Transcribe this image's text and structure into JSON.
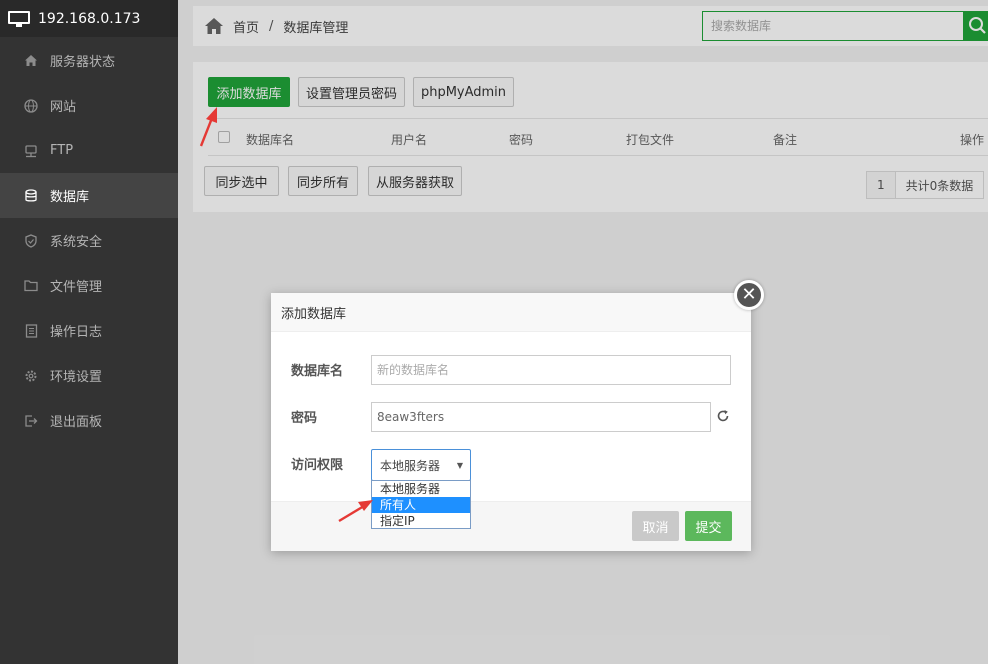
{
  "sidebar": {
    "server_ip": "192.168.0.173",
    "items": [
      {
        "label": "服务器状态",
        "icon": "home-icon"
      },
      {
        "label": "网站",
        "icon": "globe-icon"
      },
      {
        "label": "FTP",
        "icon": "ftp-icon"
      },
      {
        "label": "数据库",
        "icon": "database-icon",
        "active": true
      },
      {
        "label": "系统安全",
        "icon": "shield-icon"
      },
      {
        "label": "文件管理",
        "icon": "folder-icon"
      },
      {
        "label": "操作日志",
        "icon": "log-icon"
      },
      {
        "label": "环境设置",
        "icon": "gear-icon"
      },
      {
        "label": "退出面板",
        "icon": "logout-icon"
      }
    ]
  },
  "breadcrumb": {
    "home": "首页",
    "separator": "/",
    "current": "数据库管理"
  },
  "search": {
    "placeholder": "搜索数据库"
  },
  "toolbar": {
    "add": "添加数据库",
    "set_admin_password": "设置管理员密码",
    "phpmyadmin": "phpMyAdmin"
  },
  "table": {
    "columns": [
      "数据库名",
      "用户名",
      "密码",
      "打包文件",
      "备注",
      "操作"
    ]
  },
  "bottom_actions": {
    "sync_selected": "同步选中",
    "sync_all": "同步所有",
    "fetch_from_server": "从服务器获取"
  },
  "pager": {
    "page": "1",
    "total": "共计0条数据"
  },
  "dialog": {
    "title": "添加数据库",
    "db_name_label": "数据库名",
    "db_name_placeholder": "新的数据库名",
    "password_label": "密码",
    "password_value": "8eaw3fters",
    "access_label": "访问权限",
    "access_selected": "本地服务器",
    "access_options": [
      "本地服务器",
      "所有人",
      "指定IP"
    ],
    "highlighted_option": "所有人",
    "cancel": "取消",
    "submit": "提交"
  },
  "colors": {
    "accent_green": "#20a53a",
    "submit_green": "#5cb85c",
    "sidebar_bg": "#333333",
    "annotation_red": "#e53935"
  }
}
